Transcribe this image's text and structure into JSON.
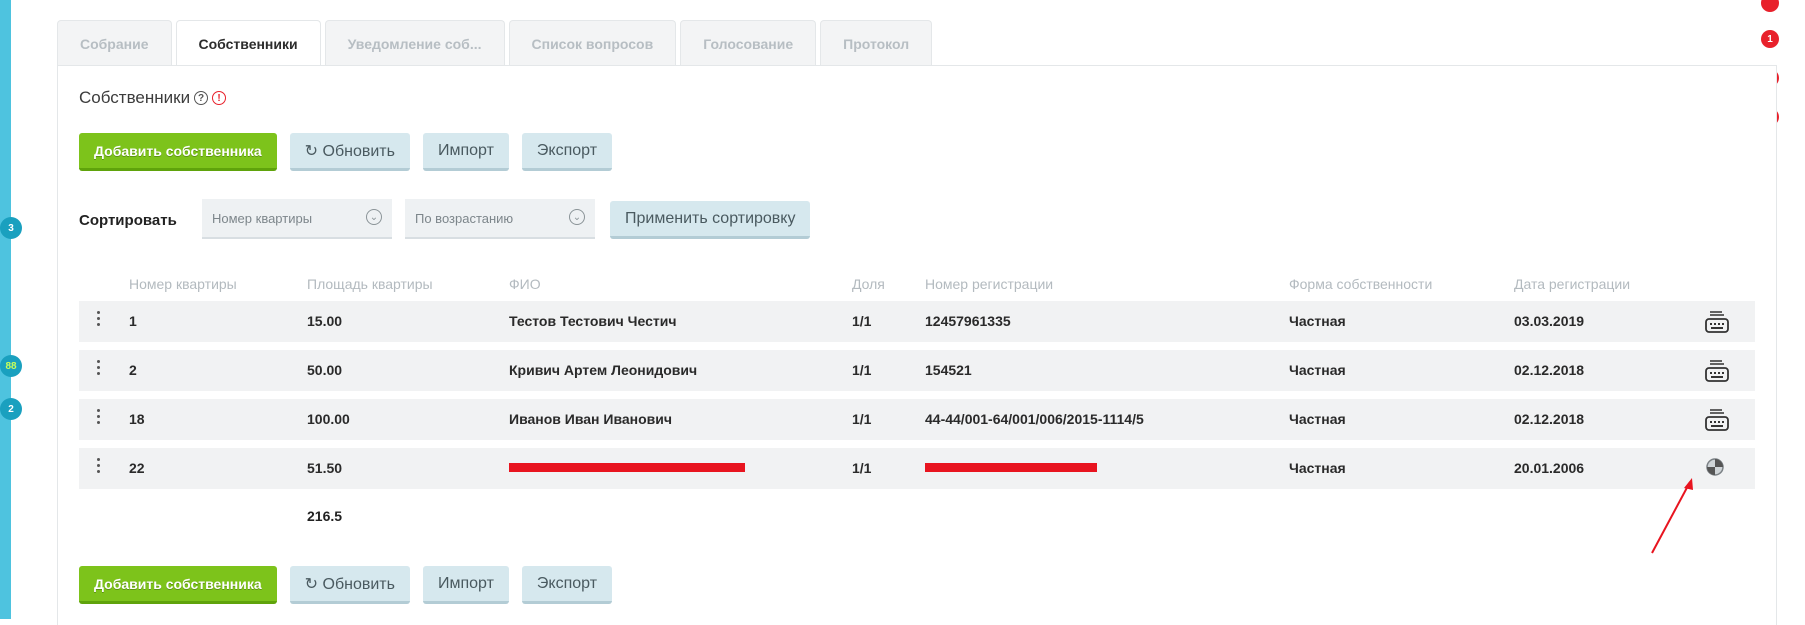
{
  "left_badges": [
    "3",
    "88",
    "2"
  ],
  "right_badges": [
    "1",
    "1",
    "1"
  ],
  "tabs": [
    "Собрание",
    "Собственники",
    "Уведомление соб...",
    "Список вопросов",
    "Голосование",
    "Протокол"
  ],
  "section": {
    "title": "Собственники"
  },
  "buttons": {
    "add": "Добавить собственника",
    "refresh": "↻ Обновить",
    "import": "Импорт",
    "export": "Экспорт"
  },
  "sort": {
    "label": "Сортировать",
    "field": "Номер квартиры",
    "order": "По возрастанию",
    "apply": "Применить сортировку"
  },
  "columns": [
    "Номер квартиры",
    "Площадь квартиры",
    "ФИО",
    "Доля",
    "Номер регистрации",
    "Форма собственности",
    "Дата регистрации"
  ],
  "rows": [
    {
      "apt": "1",
      "area": "15.00",
      "name": "Тестов Тестович Честич",
      "share": "1/1",
      "reg": "12457961335",
      "form": "Частная",
      "date": "03.03.2019"
    },
    {
      "apt": "2",
      "area": "50.00",
      "name": "Кривич Артем Леонидович",
      "share": "1/1",
      "reg": "154521",
      "form": "Частная",
      "date": "02.12.2018"
    },
    {
      "apt": "18",
      "area": "100.00",
      "name": "Иванов Иван Иванович",
      "share": "1/1",
      "reg": "44-44/001-64/001/006/2015-1114/5",
      "form": "Частная",
      "date": "02.12.2018"
    },
    {
      "apt": "22",
      "area": "51.50",
      "name": "",
      "share": "1/1",
      "reg": "",
      "form": "Частная",
      "date": "20.01.2006"
    }
  ],
  "total_area": "216.5",
  "colors": {
    "accent_green": "#7dc31b",
    "sidebar": "#4ec3df",
    "annotation_red": "#e8141f"
  }
}
